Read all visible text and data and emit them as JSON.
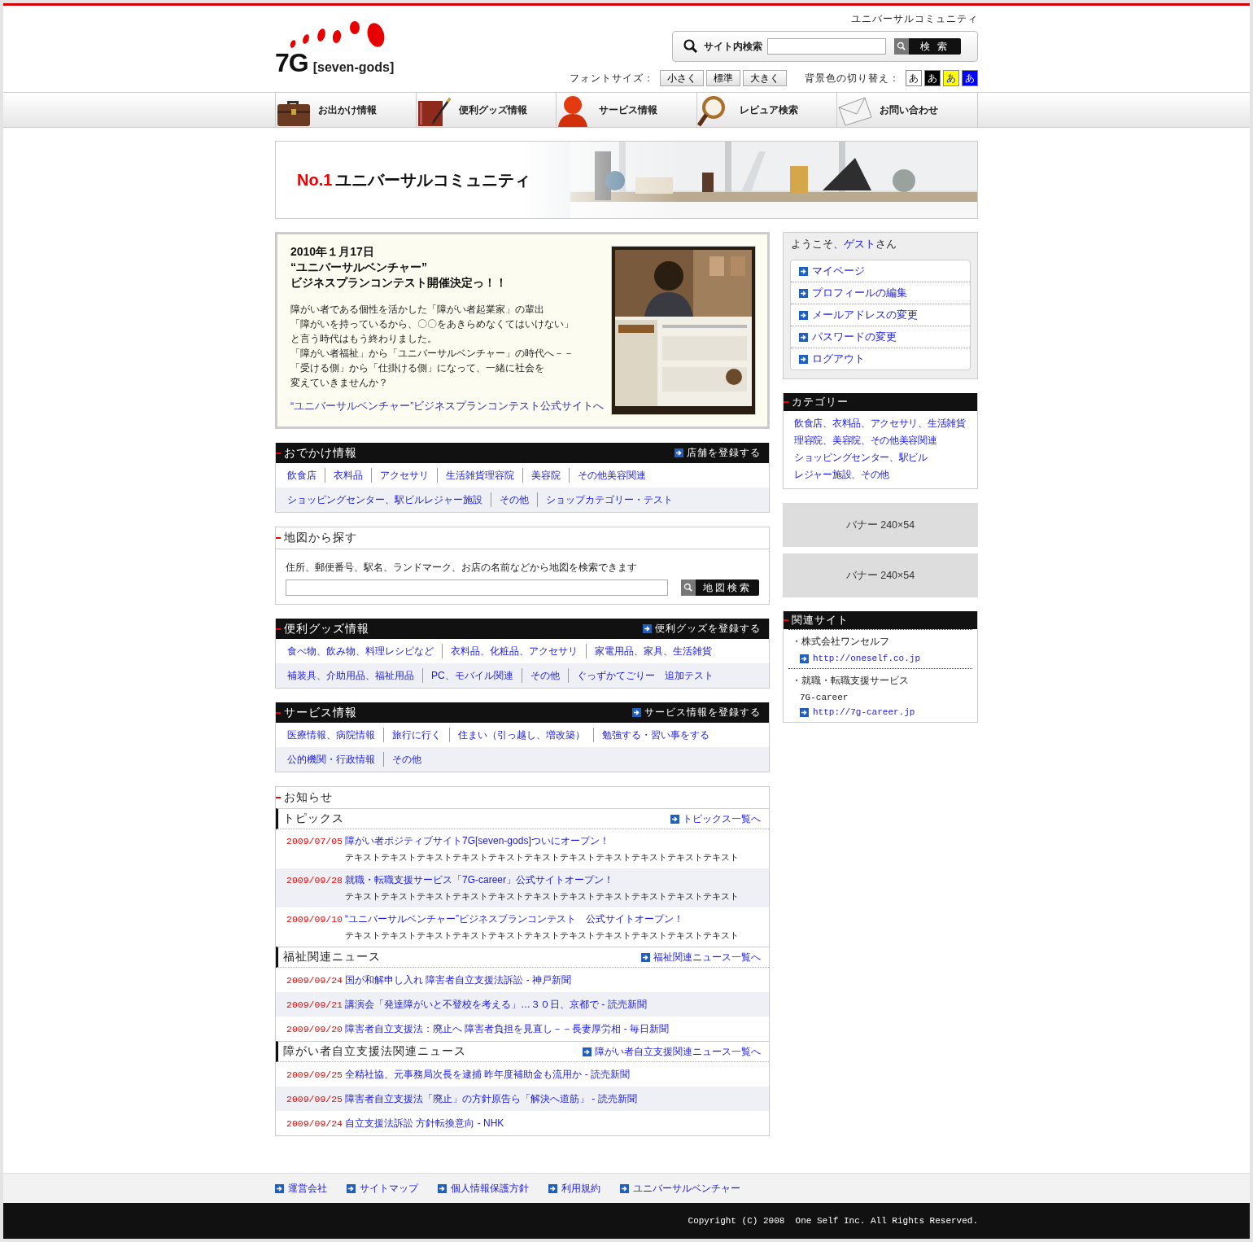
{
  "header": {
    "tagline": "ユニバーサルコミュニティ",
    "logo": {
      "mark": "7G",
      "name": "[seven-gods]"
    },
    "search": {
      "label": "サイト内検索",
      "button": "検 索"
    },
    "font_size": {
      "label": "フォントサイズ：",
      "options": [
        "小さく",
        "標準",
        "大きく"
      ]
    },
    "bg_color": {
      "label": "背景色の切り替え：",
      "options": [
        {
          "label": "あ",
          "color": "#ffffff"
        },
        {
          "label": "あ",
          "color": "#000000"
        },
        {
          "label": "あ",
          "color": "#ffff00"
        },
        {
          "label": "あ",
          "color": "#0000ff"
        }
      ]
    }
  },
  "nav": [
    {
      "label": "お出かけ情報",
      "kind": "bag"
    },
    {
      "label": "便利グッズ情報",
      "kind": "notebook"
    },
    {
      "label": "サービス情報",
      "kind": "person"
    },
    {
      "label": "レビュア検索",
      "kind": "magnifier"
    },
    {
      "label": "お問い合わせ",
      "kind": "envelope"
    }
  ],
  "hero": {
    "badge": "No.1",
    "title": "ユニバーサルコミュニティ"
  },
  "feature": {
    "date": "2010年１月17日",
    "title_lines": [
      "“ユニバーサルベンチャー”",
      "ビジネスプランコンテスト開催決定っ！！"
    ],
    "body_lines": [
      "障がい者である個性を活かした「障がい者起業家」の輩出",
      "「障がいを持っているから、〇〇をあきらめなくてはいけない」",
      "と言う時代はもう終わりました。",
      "「障がい者福祉」から「ユニバーサルベンチャー」の時代へ－－",
      "「受ける側」から「仕掛ける側」になって、一緒に社会を",
      "変えていきませんか？"
    ],
    "link": "“ユニバーサルベンチャー”ビジネスプランコンテスト公式サイトへ"
  },
  "outing": {
    "title": "おでかけ情報",
    "action": "店舗を登録する",
    "link_lines": [
      {
        "links": [
          "飲食店",
          "衣料品",
          "アクセサリ",
          "生活雑貨理容院",
          "美容院",
          "その他美容関連"
        ]
      },
      {
        "links": [
          "ショッピングセンター、駅ビルレジャー施設",
          "その他",
          "ショップカテゴリー・テスト"
        ]
      }
    ]
  },
  "map_search": {
    "title": "地図から探す",
    "hint": "住所、郵便番号、駅名、ランドマーク、お店の名前などから地図を検索できます",
    "button": "地図検索"
  },
  "goods": {
    "title": "便利グッズ情報",
    "action": "便利グッズを登録する",
    "link_lines": [
      {
        "links": [
          "食べ物、飲み物、料理レシピなど",
          "衣料品、化粧品、アクセサリ",
          "家電用品、家具、生活雑貨"
        ]
      },
      {
        "links": [
          "補装具、介助用品、福祉用品",
          "PC、モバイル関連",
          "その他",
          "ぐっずかてごりー　追加テスト"
        ]
      }
    ]
  },
  "services": {
    "title": "サービス情報",
    "action": "サービス情報を登録する",
    "link_lines": [
      {
        "links": [
          "医療情報、病院情報",
          "旅行に行く",
          "住まい（引っ越し、増改築）",
          "勉強する・習い事をする"
        ]
      },
      {
        "links": [
          "公的機関・行政情報",
          "その他"
        ]
      }
    ]
  },
  "news": {
    "title": "お知らせ",
    "groups": [
      {
        "title": "トピックス",
        "more": "トピックス一覧へ",
        "items": [
          {
            "date": "2009/07/05",
            "title": "障がい者ポジティブサイト7G[seven-gods]ついにオープン！",
            "body": "テキストテキストテキストテキストテキストテキストテキストテキストテキストテキストテキスト"
          },
          {
            "date": "2009/09/28",
            "title": "就職・転職支援サービス「7G-career」公式サイトオープン！",
            "body": "テキストテキストテキストテキストテキストテキストテキストテキストテキストテキストテキスト"
          },
          {
            "date": "2009/09/10",
            "title": "“ユニバーサルベンチャー”ビジネスプランコンテスト　公式サイトオープン！",
            "body": "テキストテキストテキストテキストテキストテキストテキストテキストテキストテキストテキスト"
          }
        ]
      },
      {
        "title": "福祉関連ニュース",
        "more": "福祉関連ニュース一覧へ",
        "items": [
          {
            "date": "2009/09/24",
            "title": "国が和解申し入れ 障害者自立支援法訴訟 - 神戸新聞"
          },
          {
            "date": "2009/09/21",
            "title": "講演会「発達障がいと不登校を考える」…３０日、京都で - 読売新聞"
          },
          {
            "date": "2009/09/20",
            "title": "障害者自立支援法：廃止へ 障害者負担を見直し－－長妻厚労相 - 毎日新聞"
          }
        ]
      },
      {
        "title": "障がい者自立支援法関連ニュース",
        "more": "障がい者自立支援関連ニュース一覧へ",
        "items": [
          {
            "date": "2009/09/25",
            "title": "全精社協、元事務局次長を逮捕 昨年度補助金も流用か - 読売新聞"
          },
          {
            "date": "2009/09/25",
            "title": "障害者自立支援法「廃止」の方針原告ら「解決へ道筋」 - 読売新聞"
          },
          {
            "date": "2009/09/24",
            "title": "自立支援法訴訟 方針転換意向 - NHK"
          }
        ]
      }
    ]
  },
  "sidebar": {
    "welcome": {
      "prefix": "ようこそ、",
      "name": "ゲスト",
      "suffix": "さん"
    },
    "account_links": [
      "マイページ",
      "プロフィールの編集",
      "メールアドレスの変更",
      "パスワードの変更",
      "ログアウト"
    ],
    "categories": {
      "title": "カテゴリー",
      "items": [
        "飲食店、衣料品、アクセサリ、生活雑貨",
        "理容院、美容院、その他美容関連",
        "ショッピングセンター、駅ビル",
        "レジャー施設、その他"
      ]
    },
    "banners": [
      "バナー 240×54",
      "バナー 240×54"
    ],
    "related": {
      "title": "関連サイト",
      "sites": [
        {
          "name": "・株式会社ワンセルフ",
          "url": "http://oneself.co.jp"
        },
        {
          "name": "・就職・転職支援サービス",
          "sub": "7G-career",
          "url": "http://7g-career.jp"
        }
      ]
    }
  },
  "footer": {
    "links": [
      "運営会社",
      "サイトマップ",
      "個人情報保護方針",
      "利用規約",
      "ユニバーサルベンチャー"
    ],
    "copyright": "Copyright (C) 2008  One Self Inc. All Rights Reserved."
  }
}
